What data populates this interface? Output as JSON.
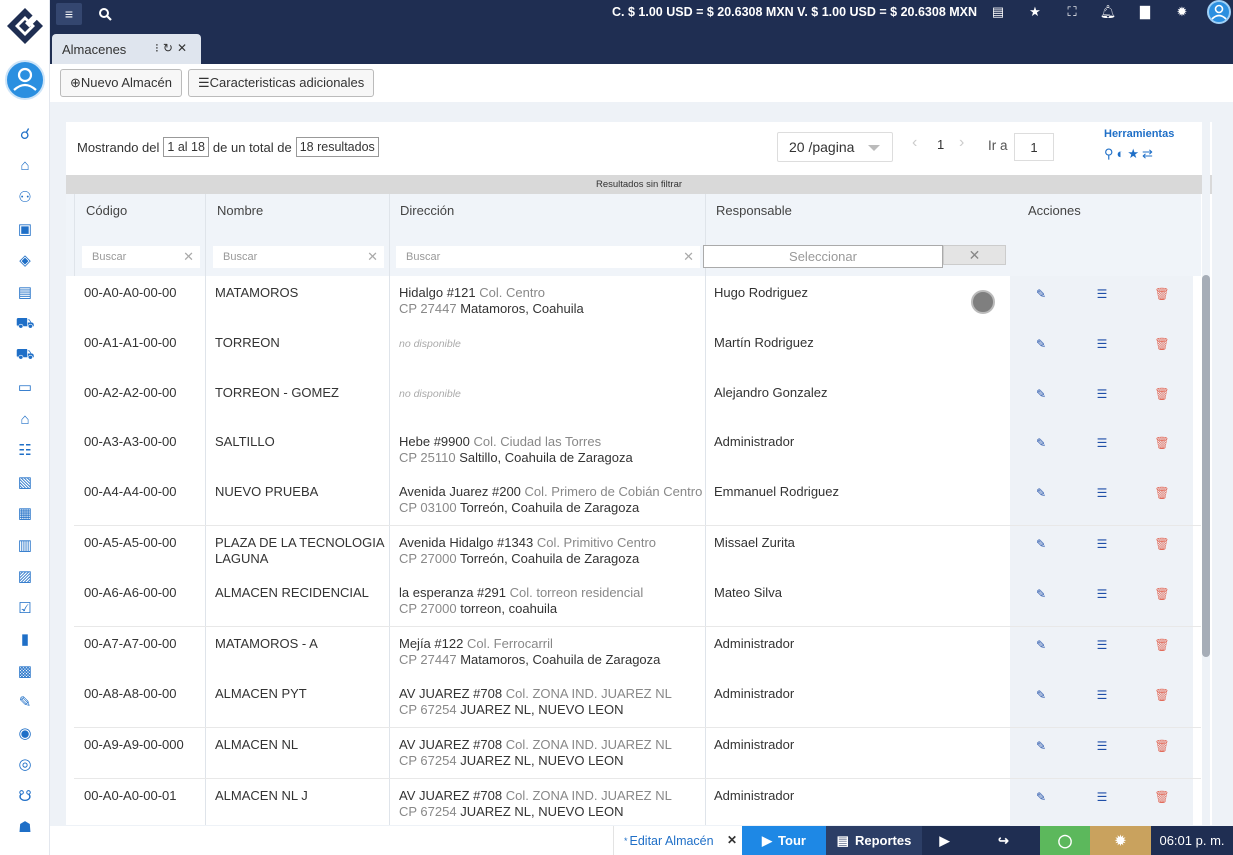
{
  "topbar": {
    "rates": "C. $ 1.00 USD = $ 20.6308 MXN   V. $ 1.00 USD = $ 20.6308 MXN",
    "menu_icon": "hamburger-icon",
    "search_icon": "search-icon"
  },
  "tab": {
    "label": "Almacenes"
  },
  "toolbar": {
    "new_label": "⊕Nuevo Almacén",
    "extra_label": "☰Caracteristicas adicionales"
  },
  "listing": {
    "showing_prefix": "Mostrando del",
    "range": "1 al 18",
    "total_prefix": "de un total de",
    "total": "18 resultados",
    "per_page": "20 /pagina",
    "current_page": "1",
    "goto_label": "Ir a",
    "goto_value": "1",
    "tools_title": "Herramientas",
    "filter_status": "Resultados sin filtrar"
  },
  "columns": {
    "code": "Código",
    "name": "Nombre",
    "address": "Dirección",
    "responsible": "Responsable",
    "actions": "Acciones"
  },
  "filters": {
    "code_placeholder": "Buscar",
    "name_placeholder": "Buscar",
    "address_placeholder": "Buscar",
    "responsible_placeholder": "Seleccionar"
  },
  "rows": [
    {
      "code": "00-A0-A0-00-00",
      "name": "MATAMOROS",
      "street": "Hidalgo #121",
      "col": "Col. Centro",
      "cp": "CP 27447",
      "city": "Matamoros, Coahuila",
      "responsible": "Hugo Rodriguez"
    },
    {
      "code": "00-A1-A1-00-00",
      "name": "TORREON",
      "na": "no disponible",
      "responsible": "Martín Rodriguez"
    },
    {
      "code": "00-A2-A2-00-00",
      "name": "TORREON - GOMEZ",
      "na": "no disponible",
      "responsible": "Alejandro Gonzalez"
    },
    {
      "code": "00-A3-A3-00-00",
      "name": "SALTILLO",
      "street": "Hebe #9900",
      "col": "Col. Ciudad las Torres",
      "cp": "CP 25110",
      "city": "Saltillo, Coahuila de Zaragoza",
      "responsible": "Administrador"
    },
    {
      "code": "00-A4-A4-00-00",
      "name": "NUEVO PRUEBA",
      "street": "Avenida Juarez #200",
      "col": "Col. Primero de Cobián Centro",
      "cp": "CP 03100",
      "city": "Torreón, Coahuila de Zaragoza",
      "responsible": "Emmanuel Rodriguez"
    },
    {
      "code": "00-A5-A5-00-00",
      "name": "PLAZA DE LA TECNOLOGIA LAGUNA",
      "street": "Avenida Hidalgo #1343",
      "col": "Col. Primitivo Centro",
      "cp": "CP 27000",
      "city": "Torreón, Coahuila de Zaragoza",
      "responsible": "Missael Zurita"
    },
    {
      "code": "00-A6-A6-00-00",
      "name": "ALMACEN RECIDENCIAL",
      "street": "la esperanza #291",
      "col": "Col. torreon residencial",
      "cp": "CP 27000",
      "city": "torreon, coahuila",
      "responsible": "Mateo Silva"
    },
    {
      "code": "00-A7-A7-00-00",
      "name": "MATAMOROS - A",
      "street": "Mejía #122",
      "col": "Col. Ferrocarril",
      "cp": "CP 27447",
      "city": "Matamoros, Coahuila de Zaragoza",
      "responsible": "Administrador"
    },
    {
      "code": "00-A8-A8-00-00",
      "name": "ALMACEN PYT",
      "street": "AV JUAREZ #708",
      "col": "Col. ZONA IND. JUAREZ NL",
      "cp": "CP 67254",
      "city": "JUAREZ NL, NUEVO LEON",
      "responsible": "Administrador"
    },
    {
      "code": "00-A9-A9-00-000",
      "name": "ALMACEN NL",
      "street": "AV JUAREZ #708",
      "col": "Col. ZONA IND. JUAREZ NL",
      "cp": "CP 67254",
      "city": "JUAREZ NL, NUEVO LEON",
      "responsible": "Administrador"
    },
    {
      "code": "00-A0-A0-00-01",
      "name": "ALMACEN NL J",
      "street": "AV JUAREZ #708",
      "col": "Col. ZONA IND. JUAREZ NL",
      "cp": "CP 67254",
      "city": "JUAREZ NL, NUEVO LEON",
      "responsible": "Administrador"
    }
  ],
  "bottombar": {
    "edit_tab": "Editar Almacén",
    "tour": "Tour",
    "reports": "Reportes",
    "time": "06:01 p. m."
  },
  "colors": {
    "navy": "#1f2e52",
    "accent_blue": "#1f6fc7",
    "tour_blue": "#1e88e5",
    "reports_navy": "#2c3e66",
    "whatsapp_green": "#5cb85c",
    "settings_gold": "#c9a25e",
    "delete_red": "#e26b5a"
  }
}
